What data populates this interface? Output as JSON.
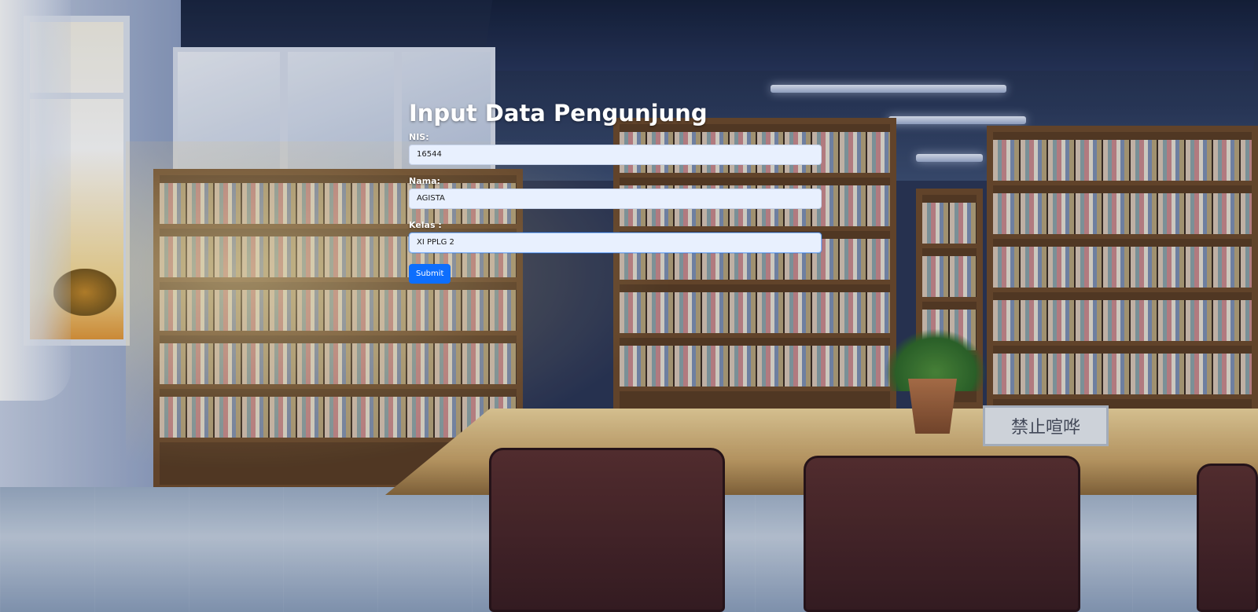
{
  "page": {
    "title": "Input Data Pengunjung"
  },
  "form": {
    "fields": [
      {
        "label": "NIS:",
        "value": "16544"
      },
      {
        "label": "Nama:",
        "value": "AGISTA"
      },
      {
        "label": "Kelas :",
        "value": "XI PPLG 2"
      }
    ],
    "submit_label": "Submit"
  },
  "background": {
    "sign_text": "禁止喧哗"
  },
  "colors": {
    "submit_button": "#0d6efd",
    "input_background": "#e8f0fe",
    "title_text": "#ffffff"
  }
}
